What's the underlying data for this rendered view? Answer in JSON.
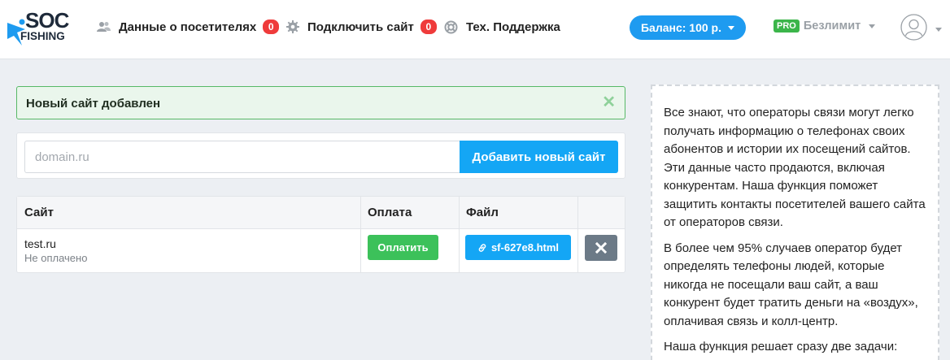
{
  "logo": {
    "soc": "SOC",
    "fishing": "FISHING"
  },
  "nav": {
    "visitors": {
      "label": "Данные о посетителях",
      "count": "0"
    },
    "connect": {
      "label": "Подключить сайт",
      "count": "0"
    },
    "support": {
      "label": "Тех. Поддержка"
    }
  },
  "balance": {
    "label": "Баланс: 100 р."
  },
  "plan": {
    "badge": "PRO",
    "label": "Безлимит"
  },
  "alert": {
    "message": "Новый сайт добавлен",
    "close": "✕"
  },
  "add_site": {
    "placeholder": "domain.ru",
    "button_label": "Добавить новый сайт"
  },
  "table": {
    "headers": {
      "site": "Сайт",
      "payment": "Оплата",
      "file": "Файл"
    },
    "rows": [
      {
        "site": "test.ru",
        "status": "Не оплачено",
        "pay_label": "Оплатить",
        "file_label": "sf-627e8.html"
      }
    ]
  },
  "info": {
    "paragraphs": [
      "Все знают, что операторы связи могут легко получать информацию о телефонах своих абонентов и истории их посещений сайтов. Эти данные часто продаются, включая конкурентам. Наша функция поможет защитить контакты посетителей вашего сайта от операторов связи.",
      "В более чем 95% случаев оператор будет определять телефоны людей, которые никогда не посещали ваш сайт, а ваш конкурент будет тратить деньги на «воздух», оплачивая связь и колл-центр.",
      "Наша функция решает сразу две задачи:"
    ]
  },
  "colors": {
    "accent": "#14a6f5",
    "success": "#3cc15a",
    "danger_badge": "#ef3b3b",
    "alert_border": "#57b866",
    "delete": "#6c7a87"
  },
  "icons": {
    "visitors": "users-icon",
    "connect": "gear-icon",
    "support": "lifebuoy-icon",
    "user": "user-avatar-icon",
    "file": "link-icon",
    "delete": "close-icon"
  }
}
